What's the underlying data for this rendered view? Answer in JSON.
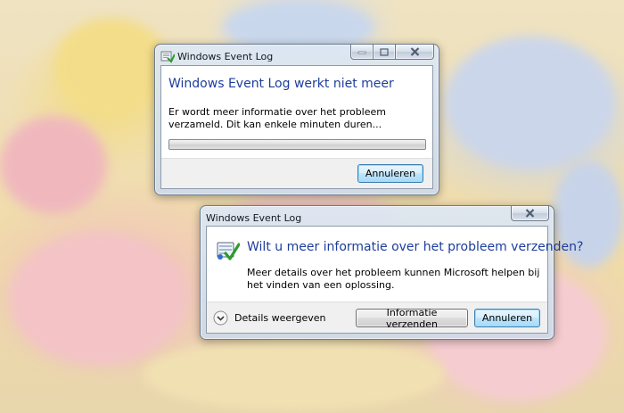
{
  "dialog1": {
    "title": "Windows Event Log",
    "heading": "Windows Event Log werkt niet meer",
    "message": "Er wordt meer informatie over het probleem verzameld. Dit kan enkele minuten duren...",
    "cancel_label": "Annuleren"
  },
  "dialog2": {
    "title": "Windows Event Log",
    "heading": "Wilt u meer informatie over het probleem verzenden?",
    "message": "Meer details over het probleem kunnen Microsoft helpen bij het vinden van een oplossing.",
    "details_label": "Details weergeven",
    "send_label": "Informatie verzenden",
    "cancel_label": "Annuleren"
  },
  "icons": {
    "title_icon": "event-log-icon",
    "dialog_icon": "error-report-icon",
    "expand_icon": "chevron-down-icon"
  },
  "colors": {
    "heading": "#1e3d9b",
    "default_button_border": "#3c7fb1"
  }
}
